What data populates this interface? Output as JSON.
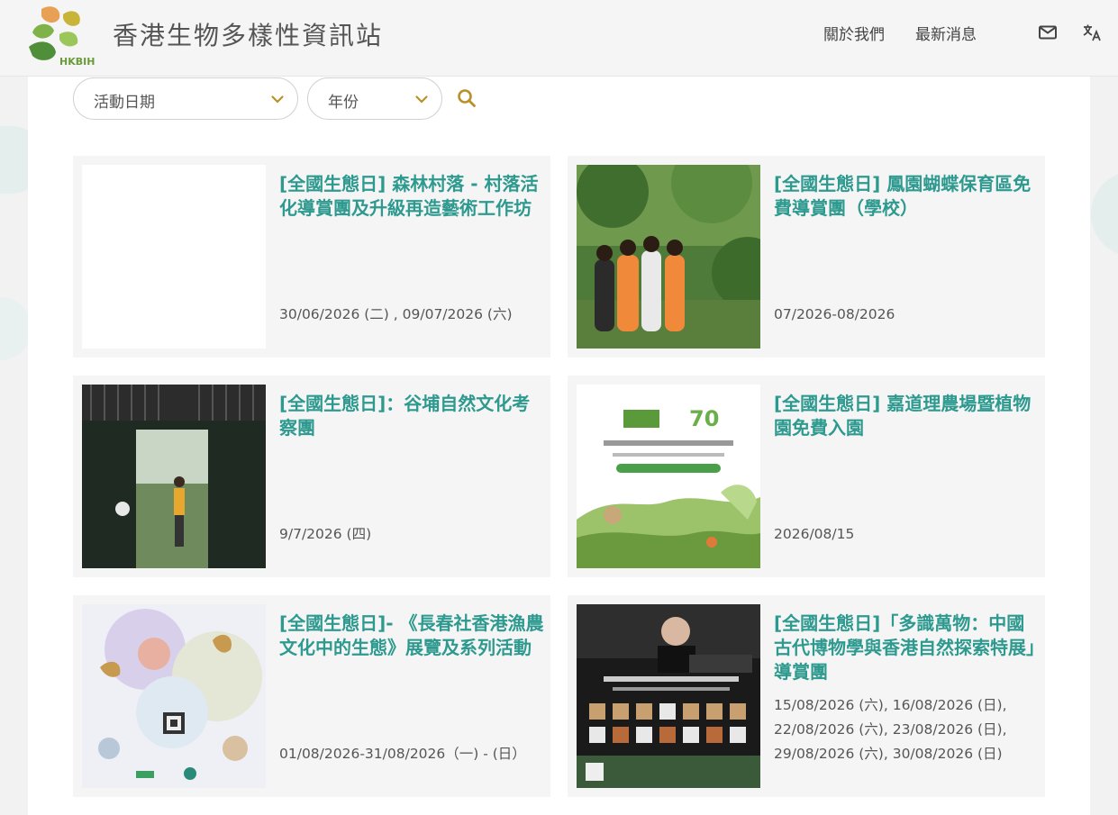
{
  "header": {
    "logo_text": "HKBIH",
    "site_title": "香港生物多樣性資訊站",
    "nav": {
      "about": "關於我們",
      "news": "最新消息"
    }
  },
  "filters": {
    "date_label": "活動日期",
    "year_label": "年份"
  },
  "cards": [
    {
      "title": "[全國生態日] 森林村落 - 村落活化導賞團及升級再造藝術工作坊",
      "date_lines": [
        "30/06/2026 (二) , 09/07/2026 (六)"
      ]
    },
    {
      "title": "[全國生態日] 鳳園蝴蝶保育區免費導賞團（學校）",
      "date_lines": [
        "07/2026-08/2026"
      ]
    },
    {
      "title": "[全國生態日]：谷埔自然文化考察團",
      "date_lines": [
        "9/7/2026 (四)"
      ]
    },
    {
      "title": "[全國生態日] 嘉道理農場暨植物園免費入園",
      "date_lines": [
        "2026/08/15"
      ]
    },
    {
      "title": "[全國生態日]- 《長春社香港漁農文化中的生態》展覽及系列活動",
      "date_lines": [
        "01/08/2026-31/08/2026（一) - (日）"
      ]
    },
    {
      "title": "[全國生態日]「多識萬物：中國古代博物學與香港自然探索特展」導賞團",
      "date_lines": [
        "15/08/2026 (六), 16/08/2026 (日),",
        "22/08/2026 (六), 23/08/2026 (日),",
        "29/08/2026 (六), 30/08/2026 (日)"
      ]
    }
  ],
  "colors": {
    "title_teal": "#2e9a8f",
    "accent_gold": "#b9902a"
  }
}
